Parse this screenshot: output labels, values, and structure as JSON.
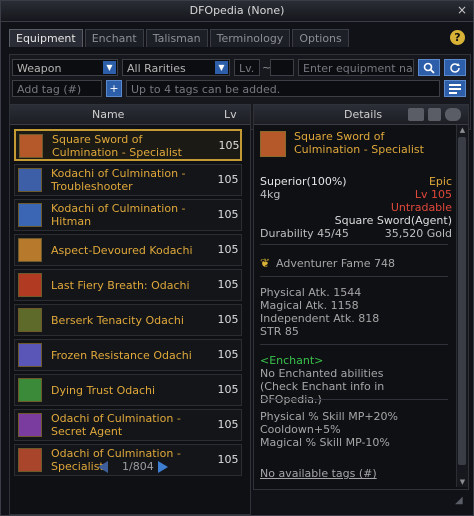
{
  "window": {
    "title": "DFOpedia (None)",
    "close_label": "×"
  },
  "tabs": [
    {
      "label": "Equipment",
      "active": true
    },
    {
      "label": "Enchant",
      "active": false
    },
    {
      "label": "Talisman",
      "active": false
    },
    {
      "label": "Terminology",
      "active": false
    },
    {
      "label": "Options",
      "active": false
    }
  ],
  "help_label": "?",
  "filters": {
    "category": "Weapon",
    "rarity": "All Rarities",
    "lv_placeholder": "Lv.",
    "lv_separator": "~",
    "search_placeholder": "Enter equipment name...",
    "tag_placeholder": "Add tag (#)",
    "tags_hint": "Up to 4 tags can be added."
  },
  "list": {
    "headers": {
      "name": "Name",
      "lv": "Lv"
    },
    "items": [
      {
        "name": "Square Sword of Culmination - Specialist",
        "lv": "105",
        "icon_color": "#b5582a"
      },
      {
        "name": "Kodachi of Culmination - Troubleshooter",
        "lv": "105",
        "icon_color": "#3d5fa8"
      },
      {
        "name": "Kodachi of Culmination - Hitman",
        "lv": "105",
        "icon_color": "#3b66b3"
      },
      {
        "name": "Aspect-Devoured Kodachi",
        "lv": "105",
        "icon_color": "#b77a2c"
      },
      {
        "name": "Last Fiery Breath: Odachi",
        "lv": "105",
        "icon_color": "#b03a22"
      },
      {
        "name": "Berserk Tenacity Odachi",
        "lv": "105",
        "icon_color": "#5e6a2a"
      },
      {
        "name": "Frozen Resistance Odachi",
        "lv": "105",
        "icon_color": "#5a56b8"
      },
      {
        "name": "Dying Trust Odachi",
        "lv": "105",
        "icon_color": "#3b8a3a"
      },
      {
        "name": "Odachi of Culmination - Secret Agent",
        "lv": "105",
        "icon_color": "#7a3c9e"
      },
      {
        "name": "Odachi of Culmination - Specialist",
        "lv": "105",
        "icon_color": "#a8452a"
      }
    ],
    "page": "1/804"
  },
  "details": {
    "header": "Details",
    "item_name": "Square Sword of Culmination - Specialist",
    "grade": "Superior(100%)",
    "rarity": "Epic",
    "weight": "4kg",
    "level": "Lv 105",
    "trade": "Untradable",
    "weapon_type": "Square Sword(Agent)",
    "durability": "Durability 45/45",
    "price": "35,520 Gold",
    "fame": "Adventurer Fame 748",
    "stats": [
      "Physical Atk. 1544",
      "Magical Atk. 1158",
      "Independent Atk. 818",
      "STR 85"
    ],
    "enchant_header": "<Enchant>",
    "enchant_lines": [
      "No Enchanted abilities",
      "(Check Enchant info in DFOpedia.)"
    ],
    "skill_lines": [
      "Physical % Skill MP+20%",
      "Cooldown+5%",
      "Magical % Skill MP-10%"
    ],
    "tags_link": "No available tags (#)"
  },
  "colors": {
    "rarity_epic": "#e0a83a",
    "highlight_red": "#e0483a",
    "enchant_green": "#39c24a",
    "selection_border": "#c49a34",
    "button_blue": "#2d5eaa"
  }
}
